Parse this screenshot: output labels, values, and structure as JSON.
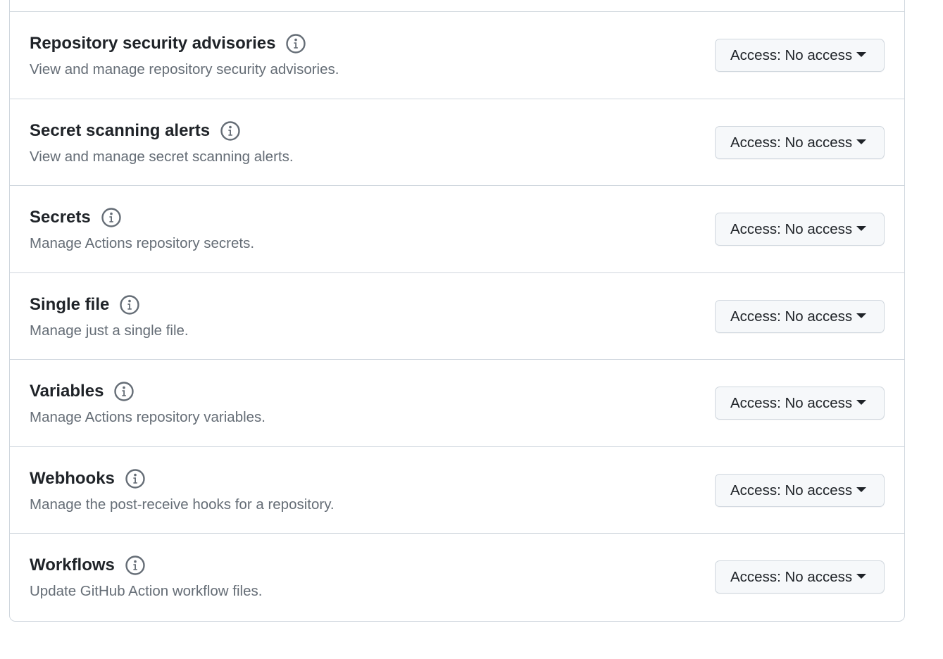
{
  "permissions": [
    {
      "title": "Repository security advisories",
      "description": "View and manage repository security advisories.",
      "access_label": "Access: No access",
      "icon": "info-icon"
    },
    {
      "title": "Secret scanning alerts",
      "description": "View and manage secret scanning alerts.",
      "access_label": "Access: No access",
      "icon": "info-icon"
    },
    {
      "title": "Secrets",
      "description": "Manage Actions repository secrets.",
      "access_label": "Access: No access",
      "icon": "info-icon"
    },
    {
      "title": "Single file",
      "description": "Manage just a single file.",
      "access_label": "Access: No access",
      "icon": "info-icon"
    },
    {
      "title": "Variables",
      "description": "Manage Actions repository variables.",
      "access_label": "Access: No access",
      "icon": "info-icon"
    },
    {
      "title": "Webhooks",
      "description": "Manage the post-receive hooks for a repository.",
      "access_label": "Access: No access",
      "icon": "info-icon"
    },
    {
      "title": "Workflows",
      "description": "Update GitHub Action workflow files.",
      "access_label": "Access: No access",
      "icon": "info-icon"
    }
  ],
  "colors": {
    "border": "#d0d7de",
    "title": "#1f2328",
    "description": "#656d76",
    "button_bg": "#f6f8fa",
    "icon": "#656d76"
  }
}
